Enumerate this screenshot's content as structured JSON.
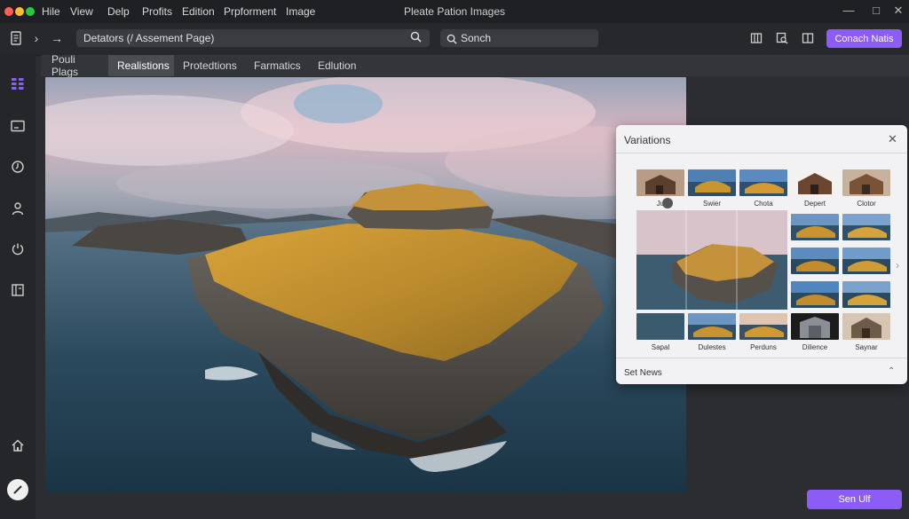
{
  "window": {
    "title": "Pleate Pation Images",
    "traffic_colors": [
      "#ff5f57",
      "#febc2e",
      "#28c840"
    ]
  },
  "menu": [
    "Hile",
    "View",
    "Delp",
    "Profits",
    "Edition",
    "Prpforment",
    "Image"
  ],
  "toolbar": {
    "path_value": "Detators (/ Assement Page)",
    "search_placeholder": "Sonch",
    "cta_label": "Conach Natis"
  },
  "tabs": [
    {
      "label": "Pouli Plags",
      "active": false
    },
    {
      "label": "Realistions",
      "active": true
    },
    {
      "label": "Protedtions",
      "active": false
    },
    {
      "label": "Farmatics",
      "active": false
    },
    {
      "label": "Edlution",
      "active": false
    }
  ],
  "rail_icons": [
    "grid-icon",
    "image-icon",
    "history-icon",
    "user-icon",
    "power-icon",
    "book-icon",
    "home-icon",
    "edit-icon"
  ],
  "panel": {
    "title": "Variations",
    "top_row_labels": [
      "Ju",
      "Swier",
      "Chota",
      "Depert",
      "Clotor"
    ],
    "bottom_row_labels": [
      "Sapal",
      "Dulestes",
      "Perduns",
      "Dilience",
      "Saynar"
    ],
    "footer": "Set News"
  },
  "bottom_button_label": "Sen Ulf",
  "accent": "#8b5cf6"
}
